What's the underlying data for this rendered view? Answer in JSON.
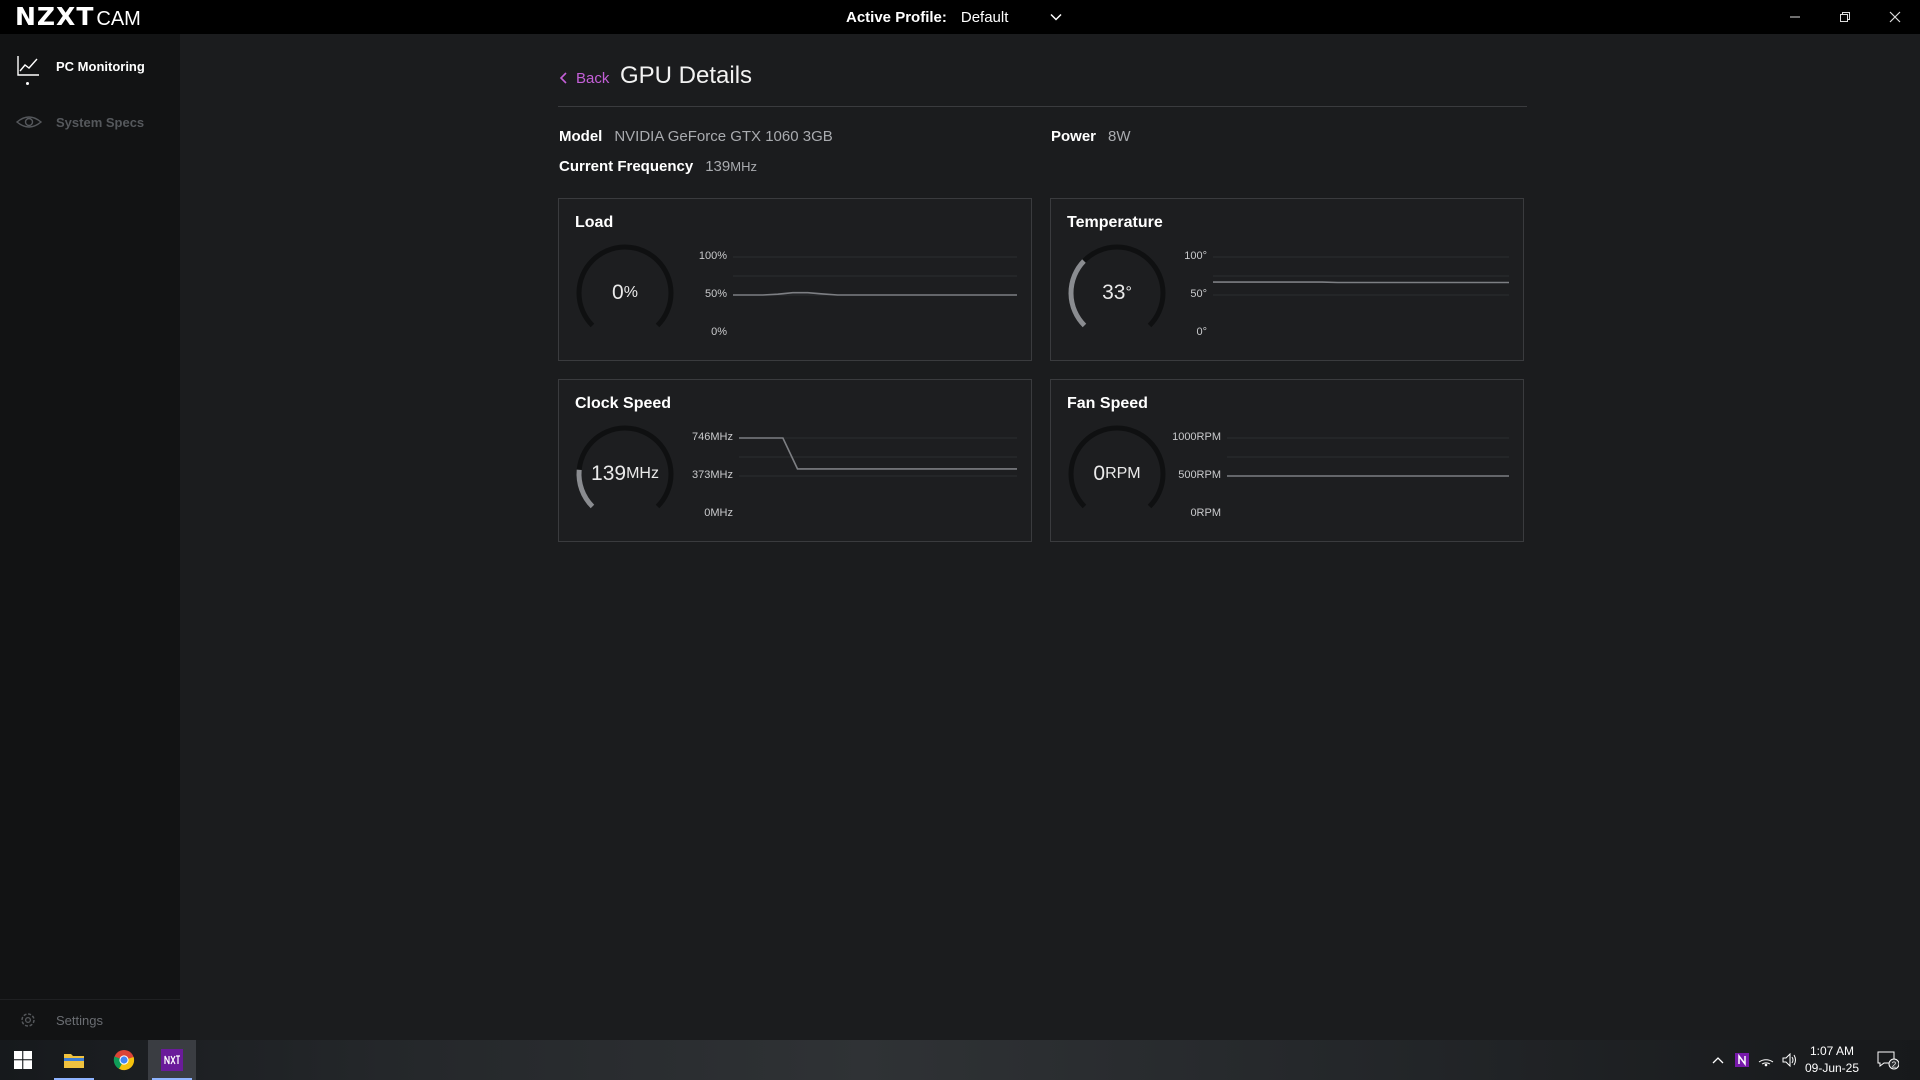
{
  "app": {
    "logo_main": "NZXT",
    "logo_sub": "CAM"
  },
  "titlebar": {
    "profile_label": "Active Profile:",
    "profile_value": "Default"
  },
  "sidebar": {
    "items": [
      {
        "label": "PC Monitoring",
        "icon": "chart-line-icon",
        "active": true
      },
      {
        "label": "System Specs",
        "icon": "eye-icon",
        "active": false
      }
    ],
    "settings_label": "Settings"
  },
  "page": {
    "back_label": "Back",
    "title": "GPU Details",
    "model_label": "Model",
    "model_value": "NVIDIA GeForce GTX 1060 3GB",
    "power_label": "Power",
    "power_value": "8W",
    "freq_label": "Current Frequency",
    "freq_value": "139",
    "freq_unit": "MHz"
  },
  "cards": {
    "load": {
      "title": "Load",
      "value": "0",
      "unit": "%",
      "gauge_fraction": 0.0,
      "axis": [
        "100%",
        "50%",
        "0%"
      ]
    },
    "temperature": {
      "title": "Temperature",
      "value": "33",
      "unit": "°",
      "gauge_fraction": 0.33,
      "axis": [
        "100°",
        "50°",
        "0°"
      ]
    },
    "clock": {
      "title": "Clock Speed",
      "value": "139",
      "unit": "MHz",
      "gauge_fraction": 0.186,
      "axis": [
        "746MHz",
        "373MHz",
        "0MHz"
      ]
    },
    "fan": {
      "title": "Fan Speed",
      "value": "0",
      "unit": "RPM",
      "gauge_fraction": 0.0,
      "axis": [
        "1000RPM",
        "500RPM",
        "0RPM"
      ]
    }
  },
  "chart_data": [
    {
      "type": "line",
      "title": "Load",
      "ylim": [
        0,
        100
      ],
      "series": [
        {
          "values": [
            0,
            0,
            0,
            2,
            6,
            6,
            3,
            0,
            0,
            0,
            0,
            0,
            0,
            0,
            0,
            0,
            0,
            0,
            0,
            0
          ]
        }
      ]
    },
    {
      "type": "line",
      "title": "Temperature",
      "ylim": [
        0,
        100
      ],
      "series": [
        {
          "values": [
            34,
            34,
            34,
            34,
            34,
            34,
            34,
            34,
            33,
            33,
            33,
            33,
            33,
            33,
            33,
            33,
            33,
            33,
            33,
            33
          ]
        }
      ]
    },
    {
      "type": "line",
      "title": "Clock Speed",
      "ylim": [
        0,
        746
      ],
      "series": [
        {
          "values": [
            746,
            746,
            746,
            746,
            139,
            139,
            139,
            139,
            139,
            139,
            139,
            139,
            139,
            139,
            139,
            139,
            139,
            139,
            139,
            139
          ]
        }
      ]
    },
    {
      "type": "line",
      "title": "Fan Speed",
      "ylim": [
        0,
        1000
      ],
      "series": [
        {
          "values": [
            0,
            0,
            0,
            0,
            0,
            0,
            0,
            0,
            0,
            0,
            0,
            0,
            0,
            0,
            0,
            0,
            0,
            0,
            0,
            0
          ]
        }
      ]
    }
  ],
  "taskbar": {
    "time": "1:07 AM",
    "date": "09-Jun-25",
    "notification_count": "2",
    "apps": [
      "windows-start-icon",
      "file-explorer-icon",
      "chrome-icon",
      "nzxt-cam-icon"
    ]
  }
}
